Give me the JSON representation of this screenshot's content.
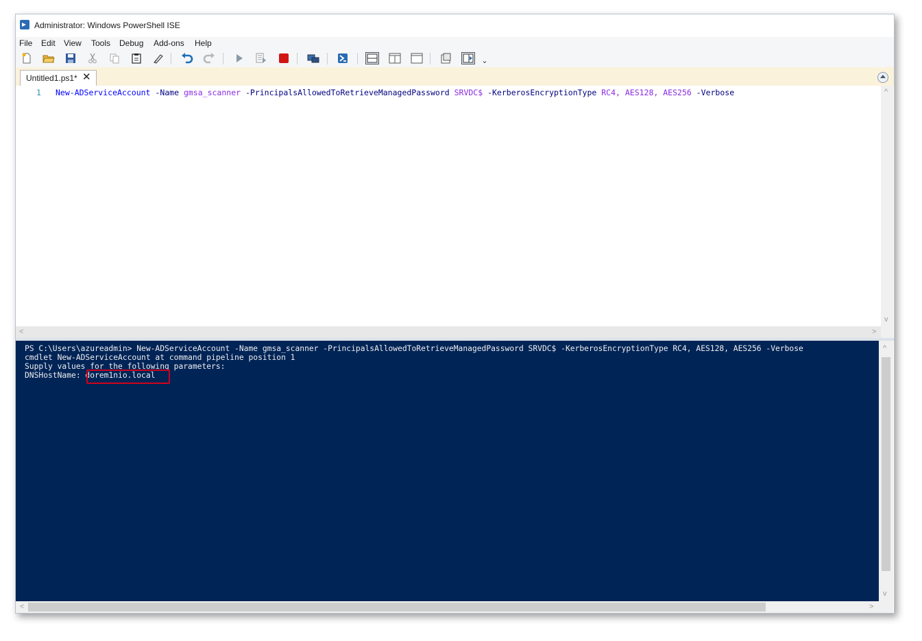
{
  "window": {
    "title": "Administrator: Windows PowerShell ISE"
  },
  "menu": [
    "File",
    "Edit",
    "View",
    "Tools",
    "Debug",
    "Add-ons",
    "Help"
  ],
  "toolbar": {
    "icons": [
      "new-script-icon",
      "open-icon",
      "save-icon",
      "cut-icon",
      "copy-icon",
      "paste-icon",
      "clear-icon",
      "undo-icon",
      "redo-icon",
      "run-icon",
      "run-selection-icon",
      "stop-icon",
      "remote-icon",
      "powershell-icon",
      "layout-top-icon",
      "layout-right-icon",
      "layout-max-icon",
      "command-addon-icon",
      "show-script-pane-icon"
    ],
    "overflow": "⌄",
    "colors": {
      "undo": "#1d6fb8",
      "stop": "#d01515",
      "run": "#5f7080"
    }
  },
  "tab": {
    "label": "Untitled1.ps1*",
    "close": "✕"
  },
  "editor": {
    "line_number": "1",
    "tokens": [
      {
        "text": "New-ADServiceAccount",
        "kind": "cmd"
      },
      {
        "text": " -Name ",
        "kind": "param"
      },
      {
        "text": "gmsa_scanner",
        "kind": "arg"
      },
      {
        "text": " -PrincipalsAllowedToRetrieveManagedPassword ",
        "kind": "param"
      },
      {
        "text": "SRVDC$",
        "kind": "arg"
      },
      {
        "text": " -KerberosEncryptionType ",
        "kind": "param"
      },
      {
        "text": "RC4, AES128, AES256",
        "kind": "arg"
      },
      {
        "text": " -Verbose",
        "kind": "param"
      }
    ]
  },
  "console": {
    "lines": [
      "PS C:\\Users\\azureadmin> New-ADServiceAccount -Name gmsa_scanner -PrincipalsAllowedToRetrieveManagedPassword SRVDC$ -KerberosEncryptionType RC4, AES128, AES256 -Verbose",
      "cmdlet New-ADServiceAccount at command pipeline position 1",
      "Supply values for the following parameters:",
      "DNSHostName: dorem1nio.local"
    ],
    "highlight_color": "#d0021b"
  },
  "scroll": {
    "left": "<",
    "right": ">",
    "up": "^",
    "down": "v"
  }
}
